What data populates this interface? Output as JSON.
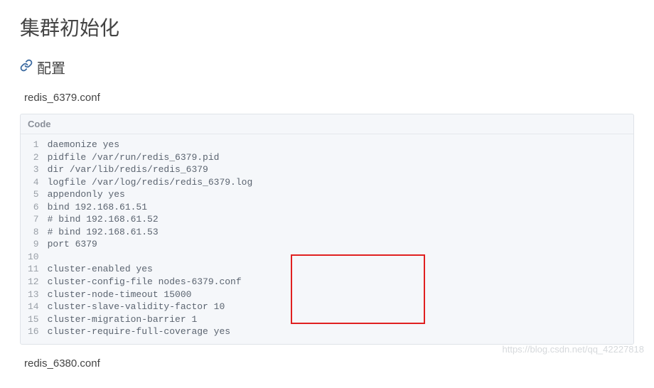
{
  "page_title": "集群初始化",
  "section": {
    "heading": "配置"
  },
  "filename1": "redis_6379.conf",
  "filename2": "redis_6380.conf",
  "code": {
    "header": "Code",
    "lines": [
      "daemonize yes",
      "pidfile /var/run/redis_6379.pid",
      "dir /var/lib/redis/redis_6379",
      "logfile /var/log/redis/redis_6379.log",
      "appendonly yes",
      "bind 192.168.61.51",
      "# bind 192.168.61.52",
      "# bind 192.168.61.53",
      "port 6379",
      "",
      "cluster-enabled yes",
      "cluster-config-file nodes-6379.conf",
      "cluster-node-timeout 15000",
      "cluster-slave-validity-factor 10",
      "cluster-migration-barrier 1",
      "cluster-require-full-coverage yes"
    ]
  },
  "watermark": "https://blog.csdn.net/qq_42227818"
}
